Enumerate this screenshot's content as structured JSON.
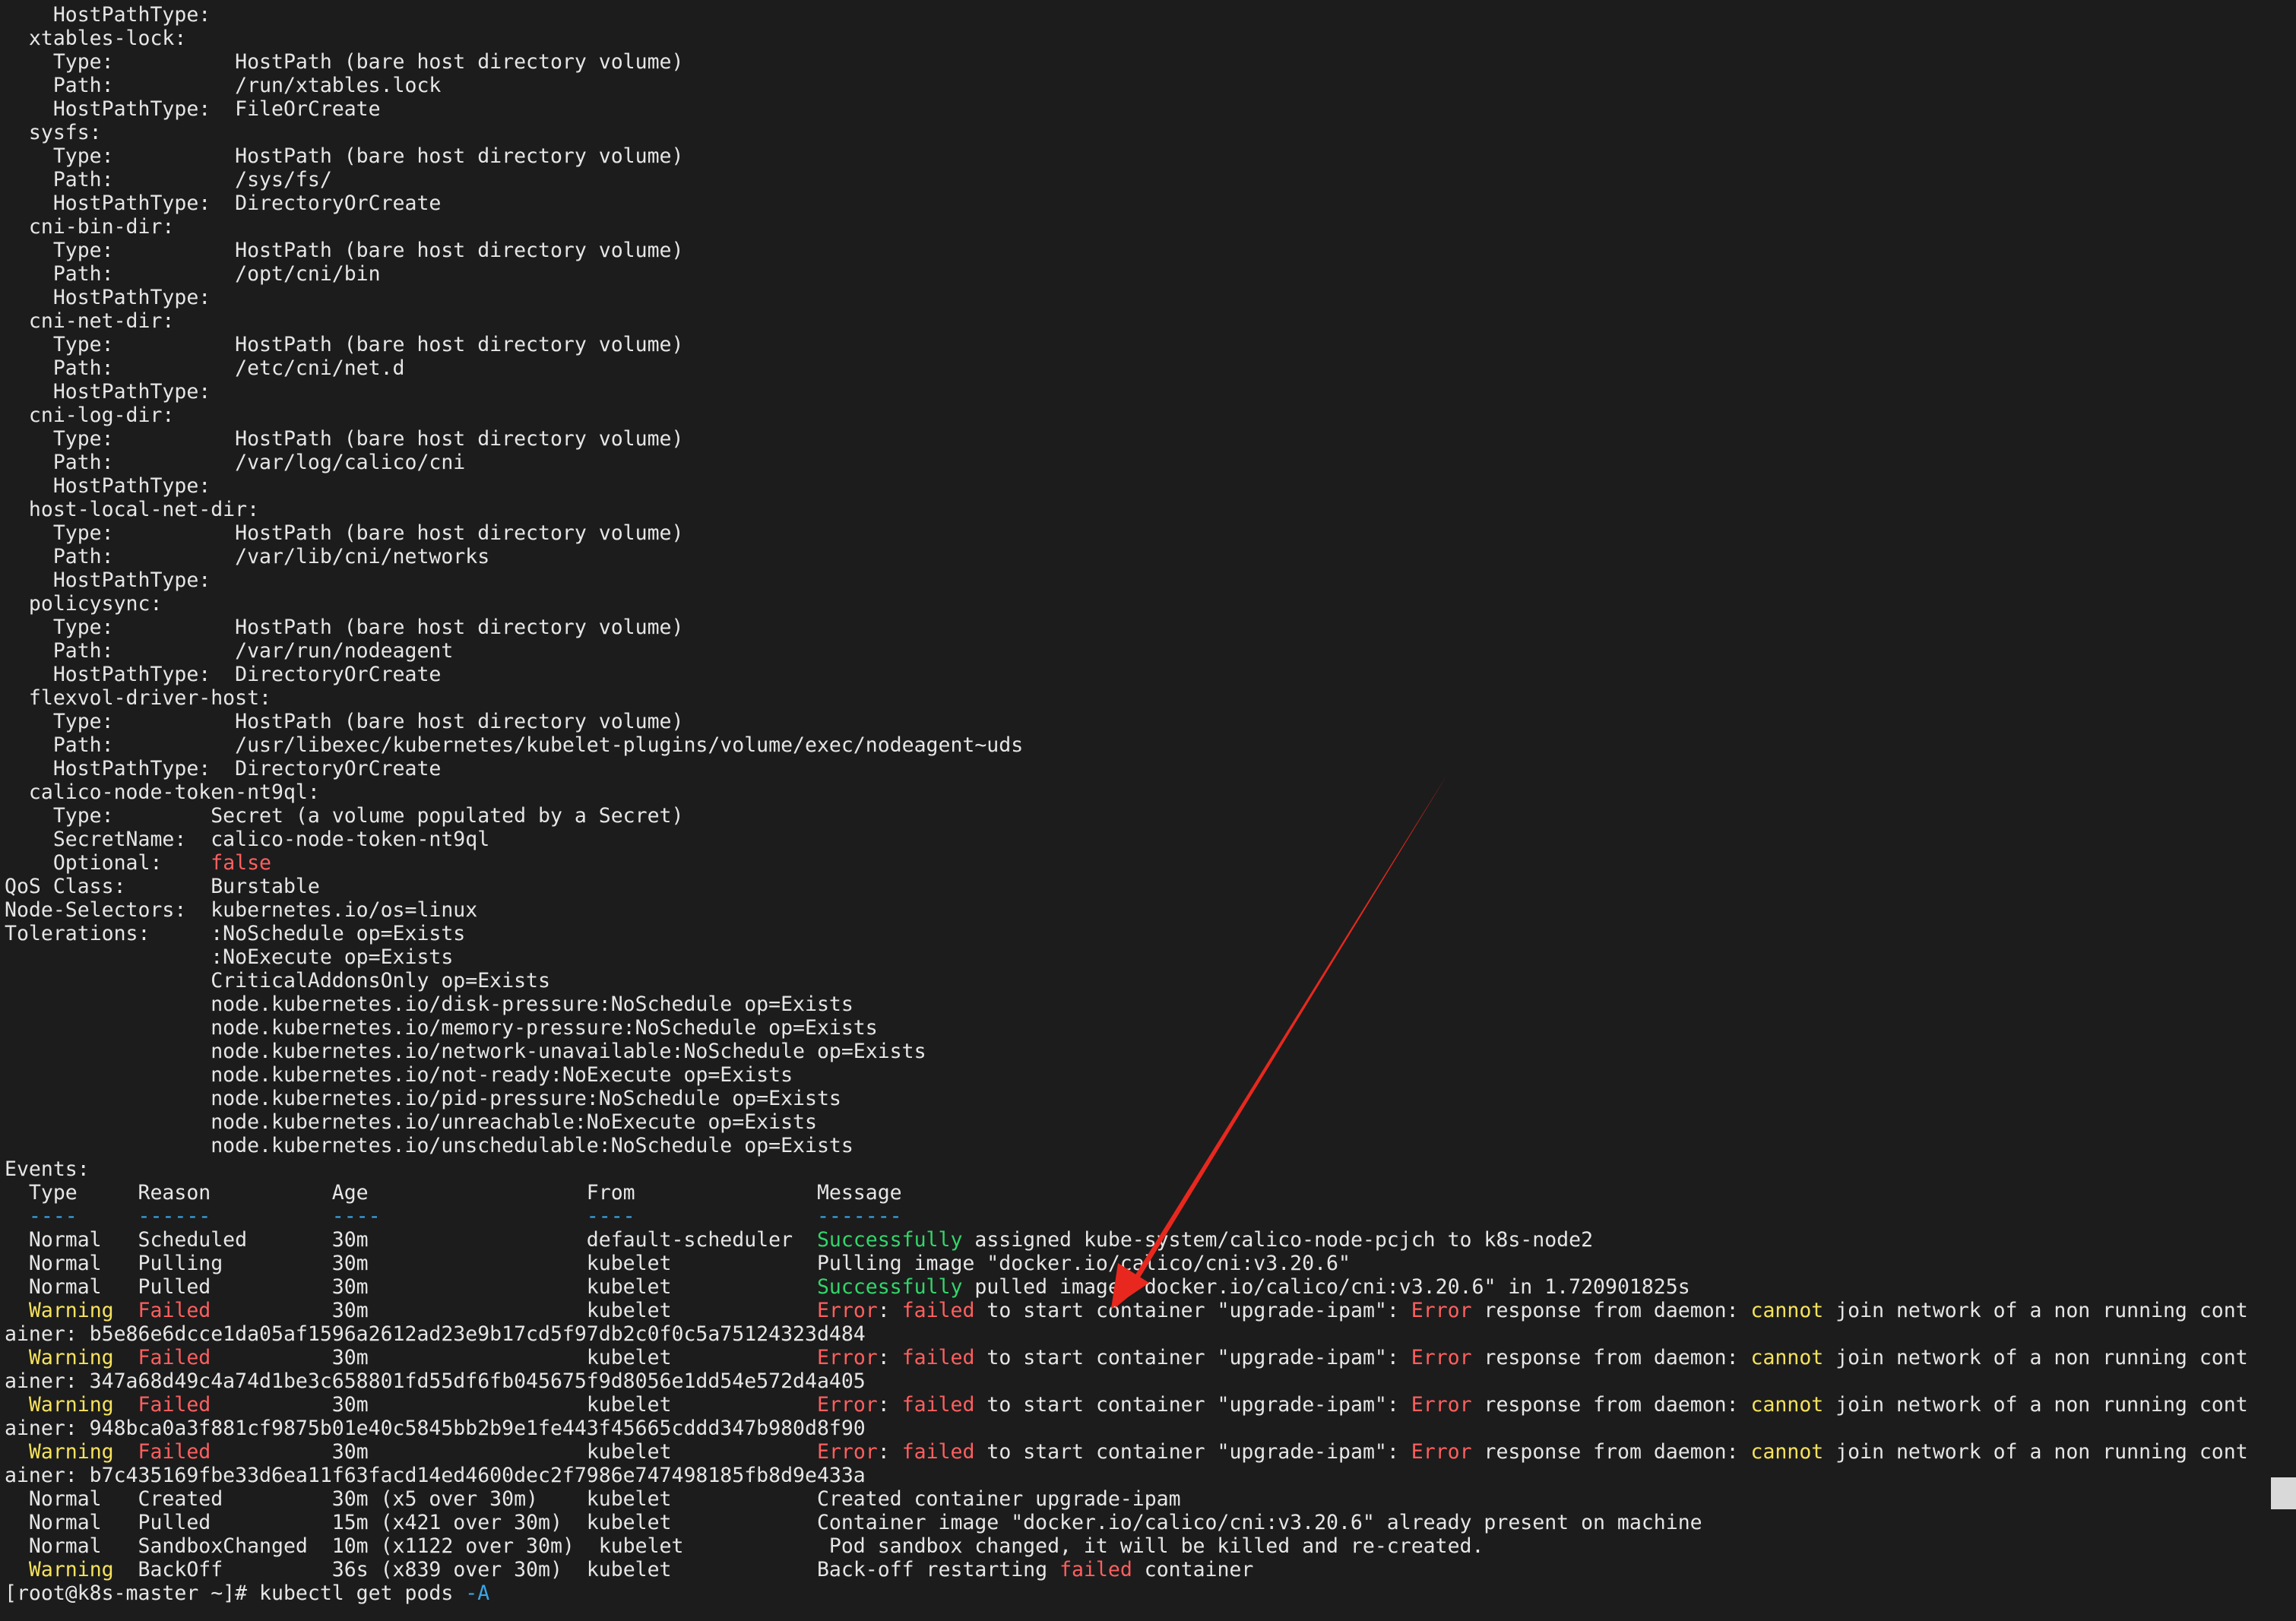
{
  "terminal": {
    "lines": [
      [
        {
          "t": "    HostPathType:"
        }
      ],
      [
        {
          "t": "  xtables-lock:"
        }
      ],
      [
        {
          "t": "    Type:          HostPath (bare host directory volume)"
        }
      ],
      [
        {
          "t": "    Path:          /run/xtables.lock"
        }
      ],
      [
        {
          "t": "    HostPathType:  FileOrCreate"
        }
      ],
      [
        {
          "t": "  sysfs:"
        }
      ],
      [
        {
          "t": "    Type:          HostPath (bare host directory volume)"
        }
      ],
      [
        {
          "t": "    Path:          /sys/fs/"
        }
      ],
      [
        {
          "t": "    HostPathType:  DirectoryOrCreate"
        }
      ],
      [
        {
          "t": "  cni-bin-dir:"
        }
      ],
      [
        {
          "t": "    Type:          HostPath (bare host directory volume)"
        }
      ],
      [
        {
          "t": "    Path:          /opt/cni/bin"
        }
      ],
      [
        {
          "t": "    HostPathType:"
        }
      ],
      [
        {
          "t": "  cni-net-dir:"
        }
      ],
      [
        {
          "t": "    Type:          HostPath (bare host directory volume)"
        }
      ],
      [
        {
          "t": "    Path:          /etc/cni/net.d"
        }
      ],
      [
        {
          "t": "    HostPathType:"
        }
      ],
      [
        {
          "t": "  cni-log-dir:"
        }
      ],
      [
        {
          "t": "    Type:          HostPath (bare host directory volume)"
        }
      ],
      [
        {
          "t": "    Path:          /var/log/calico/cni"
        }
      ],
      [
        {
          "t": "    HostPathType:"
        }
      ],
      [
        {
          "t": "  host-local-net-dir:"
        }
      ],
      [
        {
          "t": "    Type:          HostPath (bare host directory volume)"
        }
      ],
      [
        {
          "t": "    Path:          /var/lib/cni/networks"
        }
      ],
      [
        {
          "t": "    HostPathType:"
        }
      ],
      [
        {
          "t": "  policysync:"
        }
      ],
      [
        {
          "t": "    Type:          HostPath (bare host directory volume)"
        }
      ],
      [
        {
          "t": "    Path:          /var/run/nodeagent"
        }
      ],
      [
        {
          "t": "    HostPathType:  DirectoryOrCreate"
        }
      ],
      [
        {
          "t": "  flexvol-driver-host:"
        }
      ],
      [
        {
          "t": "    Type:          HostPath (bare host directory volume)"
        }
      ],
      [
        {
          "t": "    Path:          /usr/libexec/kubernetes/kubelet-plugins/volume/exec/nodeagent~uds"
        }
      ],
      [
        {
          "t": "    HostPathType:  DirectoryOrCreate"
        }
      ],
      [
        {
          "t": "  calico-node-token-nt9ql:"
        }
      ],
      [
        {
          "t": "    Type:        Secret (a volume populated by a Secret)"
        }
      ],
      [
        {
          "t": "    SecretName:  calico-node-token-nt9ql"
        }
      ],
      [
        {
          "t": "    Optional:    "
        },
        {
          "t": "false",
          "c": "red"
        }
      ],
      [
        {
          "t": "QoS Class:       Burstable"
        }
      ],
      [
        {
          "t": "Node-Selectors:  kubernetes.io/os=linux"
        }
      ],
      [
        {
          "t": "Tolerations:     :NoSchedule op=Exists"
        }
      ],
      [
        {
          "t": "                 :NoExecute op=Exists"
        }
      ],
      [
        {
          "t": "                 CriticalAddonsOnly op=Exists"
        }
      ],
      [
        {
          "t": "                 node.kubernetes.io/disk-pressure:NoSchedule op=Exists"
        }
      ],
      [
        {
          "t": "                 node.kubernetes.io/memory-pressure:NoSchedule op=Exists"
        }
      ],
      [
        {
          "t": "                 node.kubernetes.io/network-unavailable:NoSchedule op=Exists"
        }
      ],
      [
        {
          "t": "                 node.kubernetes.io/not-ready:NoExecute op=Exists"
        }
      ],
      [
        {
          "t": "                 node.kubernetes.io/pid-pressure:NoSchedule op=Exists"
        }
      ],
      [
        {
          "t": "                 node.kubernetes.io/unreachable:NoExecute op=Exists"
        }
      ],
      [
        {
          "t": "                 node.kubernetes.io/unschedulable:NoSchedule op=Exists"
        }
      ],
      [
        {
          "t": "Events:"
        }
      ],
      [
        {
          "t": "  Type     Reason          Age                  From               Message"
        }
      ],
      [
        {
          "t": "  ----     ------          ----                 ----               -------",
          "c": "cyan"
        }
      ],
      [
        {
          "t": "  Normal   Scheduled       30m                  default-scheduler  "
        },
        {
          "t": "Successfully",
          "c": "green"
        },
        {
          "t": " assigned kube-system/calico-node-pcjch to k8s-node2"
        }
      ],
      [
        {
          "t": "  Normal   Pulling         30m                  kubelet            Pulling image \"docker.io/calico/cni:v3.20.6\""
        }
      ],
      [
        {
          "t": "  Normal   Pulled          30m                  kubelet            "
        },
        {
          "t": "Successfully",
          "c": "green"
        },
        {
          "t": " pulled image \"docker.io/calico/cni:v3.20.6\" in 1.720901825s"
        }
      ],
      [
        {
          "t": "  "
        },
        {
          "t": "Warning",
          "c": "yellow"
        },
        {
          "t": "  "
        },
        {
          "t": "Failed",
          "c": "red"
        },
        {
          "t": "          30m                  kubelet            "
        },
        {
          "t": "Error",
          "c": "red"
        },
        {
          "t": ": "
        },
        {
          "t": "failed",
          "c": "red"
        },
        {
          "t": " to start container \"upgrade-ipam\": "
        },
        {
          "t": "Error",
          "c": "red"
        },
        {
          "t": " response from daemon: "
        },
        {
          "t": "cannot",
          "c": "yellow"
        },
        {
          "t": " join network of a non running cont"
        }
      ],
      [
        {
          "t": "ainer: b5e86e6dcce1da05af1596a2612ad23e9b17cd5f97db2c0f0c5a75124323d484"
        }
      ],
      [
        {
          "t": "  "
        },
        {
          "t": "Warning",
          "c": "yellow"
        },
        {
          "t": "  "
        },
        {
          "t": "Failed",
          "c": "red"
        },
        {
          "t": "          30m                  kubelet            "
        },
        {
          "t": "Error",
          "c": "red"
        },
        {
          "t": ": "
        },
        {
          "t": "failed",
          "c": "red"
        },
        {
          "t": " to start container \"upgrade-ipam\": "
        },
        {
          "t": "Error",
          "c": "red"
        },
        {
          "t": " response from daemon: "
        },
        {
          "t": "cannot",
          "c": "yellow"
        },
        {
          "t": " join network of a non running cont"
        }
      ],
      [
        {
          "t": "ainer: 347a68d49c4a74d1be3c658801fd55df6fb045675f9d8056e1dd54e572d4a405"
        }
      ],
      [
        {
          "t": "  "
        },
        {
          "t": "Warning",
          "c": "yellow"
        },
        {
          "t": "  "
        },
        {
          "t": "Failed",
          "c": "red"
        },
        {
          "t": "          30m                  kubelet            "
        },
        {
          "t": "Error",
          "c": "red"
        },
        {
          "t": ": "
        },
        {
          "t": "failed",
          "c": "red"
        },
        {
          "t": " to start container \"upgrade-ipam\": "
        },
        {
          "t": "Error",
          "c": "red"
        },
        {
          "t": " response from daemon: "
        },
        {
          "t": "cannot",
          "c": "yellow"
        },
        {
          "t": " join network of a non running cont"
        }
      ],
      [
        {
          "t": "ainer: 948bca0a3f881cf9875b01e40c5845bb2b9e1fe443f45665cddd347b980d8f90"
        }
      ],
      [
        {
          "t": "  "
        },
        {
          "t": "Warning",
          "c": "yellow"
        },
        {
          "t": "  "
        },
        {
          "t": "Failed",
          "c": "red"
        },
        {
          "t": "          30m                  kubelet            "
        },
        {
          "t": "Error",
          "c": "red"
        },
        {
          "t": ": "
        },
        {
          "t": "failed",
          "c": "red"
        },
        {
          "t": " to start container \"upgrade-ipam\": "
        },
        {
          "t": "Error",
          "c": "red"
        },
        {
          "t": " response from daemon: "
        },
        {
          "t": "cannot",
          "c": "yellow"
        },
        {
          "t": " join network of a non running cont"
        }
      ],
      [
        {
          "t": "ainer: b7c435169fbe33d6ea11f63facd14ed4600dec2f7986e747498185fb8d9e433a"
        }
      ],
      [
        {
          "t": "  Normal   Created         30m (x5 over 30m)    kubelet            Created container upgrade-ipam"
        }
      ],
      [
        {
          "t": "  Normal   Pulled          15m (x421 over 30m)  kubelet            Container image \"docker.io/calico/cni:v3.20.6\" already present on machine"
        }
      ],
      [
        {
          "t": "  Normal   SandboxChanged  10m (x1122 over 30m)  kubelet            Pod sandbox changed, it will be killed and re-created."
        }
      ],
      [
        {
          "t": "  "
        },
        {
          "t": "Warning",
          "c": "yellow"
        },
        {
          "t": "  BackOff         36s (x839 over 30m)  kubelet            Back-off restarting "
        },
        {
          "t": "failed",
          "c": "red"
        },
        {
          "t": " container"
        }
      ],
      [
        {
          "t": "[root@k8s-master ~]# kubectl get pods "
        },
        {
          "t": "-A",
          "c": "cyan"
        }
      ]
    ]
  },
  "colors": {
    "background": "#1c1c1c",
    "foreground": "#e6e6e6",
    "red": "#ff5f5f",
    "yellow": "#f6e25c",
    "green": "#32d66b",
    "cyan": "#3aa6e6",
    "annotation_arrow": "#e8281e"
  }
}
